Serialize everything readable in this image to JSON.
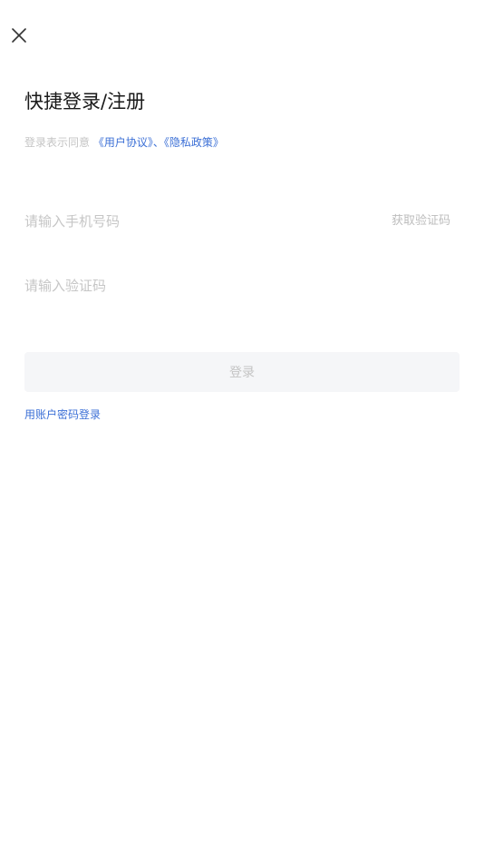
{
  "close": {
    "icon": "close-icon"
  },
  "title": "快捷登录/注册",
  "agreement": {
    "prefix": "登录表示同意",
    "user_agreement": "《用户协议》",
    "separator": "、",
    "privacy_policy": "《隐私政策》"
  },
  "phone": {
    "placeholder": "请输入手机号码",
    "get_code_label": "获取验证码"
  },
  "code": {
    "placeholder": "请输入验证码"
  },
  "login_button": "登录",
  "alt_login": "用账户密码登录",
  "colors": {
    "link": "#3b6fd6",
    "disabled_text": "#c4c4c4",
    "button_bg": "#f5f6f8"
  }
}
